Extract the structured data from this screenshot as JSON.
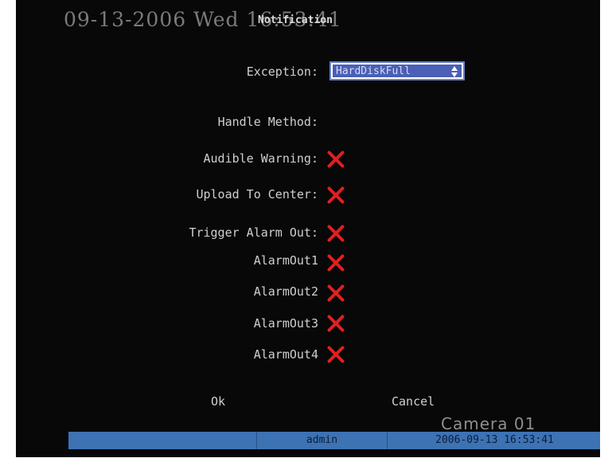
{
  "osd": {
    "datetime": "09-13-2006 Wed 16:53:41",
    "camera": "Camera 01"
  },
  "window": {
    "title": "Notification"
  },
  "form": {
    "exception_label": "Exception:",
    "exception_value": "HardDiskFull",
    "handle_method_label": "Handle Method:",
    "audible_warning_label": "Audible Warning:",
    "upload_center_label": "Upload To Center:",
    "trigger_alarm_label": "Trigger Alarm Out:",
    "alarm_outputs": [
      "AlarmOut1",
      "AlarmOut2",
      "AlarmOut3",
      "AlarmOut4"
    ]
  },
  "buttons": {
    "ok": "Ok",
    "cancel": "Cancel"
  },
  "statusbar": {
    "user": "admin",
    "datetime": "2006-09-13 16:53:41"
  },
  "colors": {
    "checkbox_off": "#e21f1f",
    "select_bg": "#4a5fb5",
    "statusbar_bg": "#3d72b3"
  }
}
